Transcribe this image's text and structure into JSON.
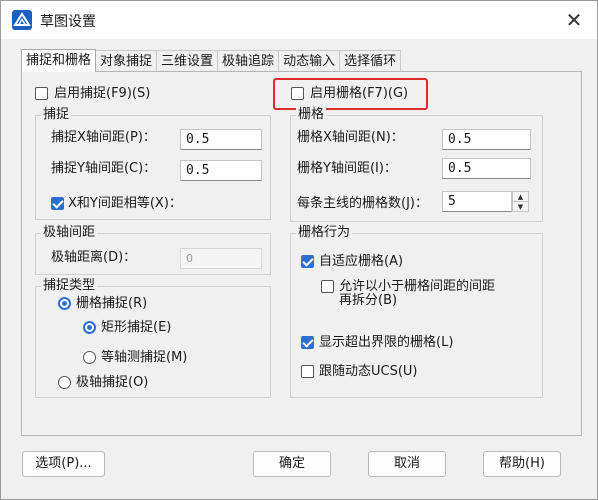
{
  "window": {
    "title": "草图设置",
    "close_glyph": "✕"
  },
  "tabs": [
    "捕捉和栅格",
    "对象捕捉",
    "三维设置",
    "极轴追踪",
    "动态输入",
    "选择循环"
  ],
  "snap": {
    "enable_label": "启用捕捉(F9)(S)",
    "enable_checked": false,
    "group_title": "捕捉",
    "x_spacing_label": "捕捉X轴间距(P)：",
    "x_spacing_value": "0.5",
    "y_spacing_label": "捕捉Y轴间距(C)：",
    "y_spacing_value": "0.5",
    "equal_label": "X和Y间距相等(X)：",
    "equal_checked": true
  },
  "polar": {
    "group_title": "极轴间距",
    "distance_label": "极轴距离(D)：",
    "distance_value": "0"
  },
  "snap_type": {
    "group_title": "捕捉类型",
    "grid_snap_label": "栅格捕捉(R)",
    "rect_snap_label": "矩形捕捉(E)",
    "iso_snap_label": "等轴测捕捉(M)",
    "polar_snap_label": "极轴捕捉(O)"
  },
  "grid": {
    "enable_label": "启用栅格(F7)(G)",
    "enable_checked": false,
    "group_title": "栅格",
    "x_spacing_label": "栅格X轴间距(N)：",
    "x_spacing_value": "0.5",
    "y_spacing_label": "栅格Y轴间距(I)：",
    "y_spacing_value": "0.5",
    "major_label": "每条主线的栅格数(J)：",
    "major_value": "5"
  },
  "grid_behavior": {
    "group_title": "栅格行为",
    "adaptive_label": "自适应栅格(A)",
    "adaptive_checked": true,
    "subdivide_label_line1": "允许以小于栅格间距的间距",
    "subdivide_label_line2": "再拆分(B)",
    "subdivide_checked": false,
    "beyond_label": "显示超出界限的栅格(L)",
    "beyond_checked": true,
    "follow_label": "跟随动态UCS(U)",
    "follow_checked": false
  },
  "buttons": {
    "options": "选项(P)...",
    "ok": "确定",
    "cancel": "取消",
    "help": "帮助(H)"
  },
  "colors": {
    "accent": "#2d6ed1",
    "highlight": "#e02b2b"
  }
}
